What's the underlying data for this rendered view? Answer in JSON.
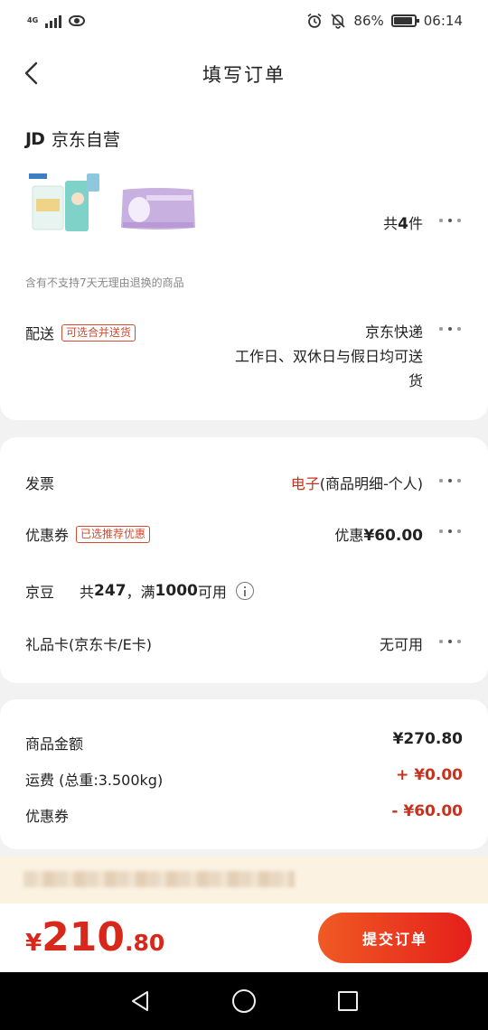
{
  "status": {
    "network": "4G",
    "battery": "86%",
    "time": "06:14"
  },
  "nav": {
    "title": "填写订单"
  },
  "shop": {
    "logo": "JD",
    "name": "京东自营"
  },
  "products": {
    "qty_prefix": "共",
    "qty_count": "4",
    "qty_suffix": "件",
    "notice": "含有不支持7天无理由退换的商品"
  },
  "delivery": {
    "label": "配送",
    "tag": "可选合并送货",
    "method": "京东快递",
    "time_line1": "工作日、双休日与假日均可送",
    "time_line2": "货"
  },
  "invoice": {
    "label": "发票",
    "type": "电子",
    "detail": "(商品明细-个人)"
  },
  "coupon": {
    "label": "优惠券",
    "tag": "已选推荐优惠",
    "prefix": "优惠",
    "amount": "¥60.00"
  },
  "beans": {
    "label": "京豆",
    "prefix": "共",
    "count": "247",
    "mid": "，满",
    "threshold": "1000",
    "suffix": "可用"
  },
  "giftcard": {
    "label": "礼品卡(京东卡/E卡)",
    "value": "无可用"
  },
  "amounts": {
    "goods_label": "商品金额",
    "goods_value": "¥270.80",
    "freight_label": "运费 (总重:3.500kg)",
    "freight_value": "+ ¥0.00",
    "coupon_label": "优惠券",
    "coupon_value": "- ¥60.00"
  },
  "footer": {
    "currency": "¥",
    "total_int": "210",
    "total_dec": ".80",
    "submit_label": "提交订单"
  },
  "colors": {
    "accent": "#e51f1b",
    "tag": "#d44a2e"
  }
}
